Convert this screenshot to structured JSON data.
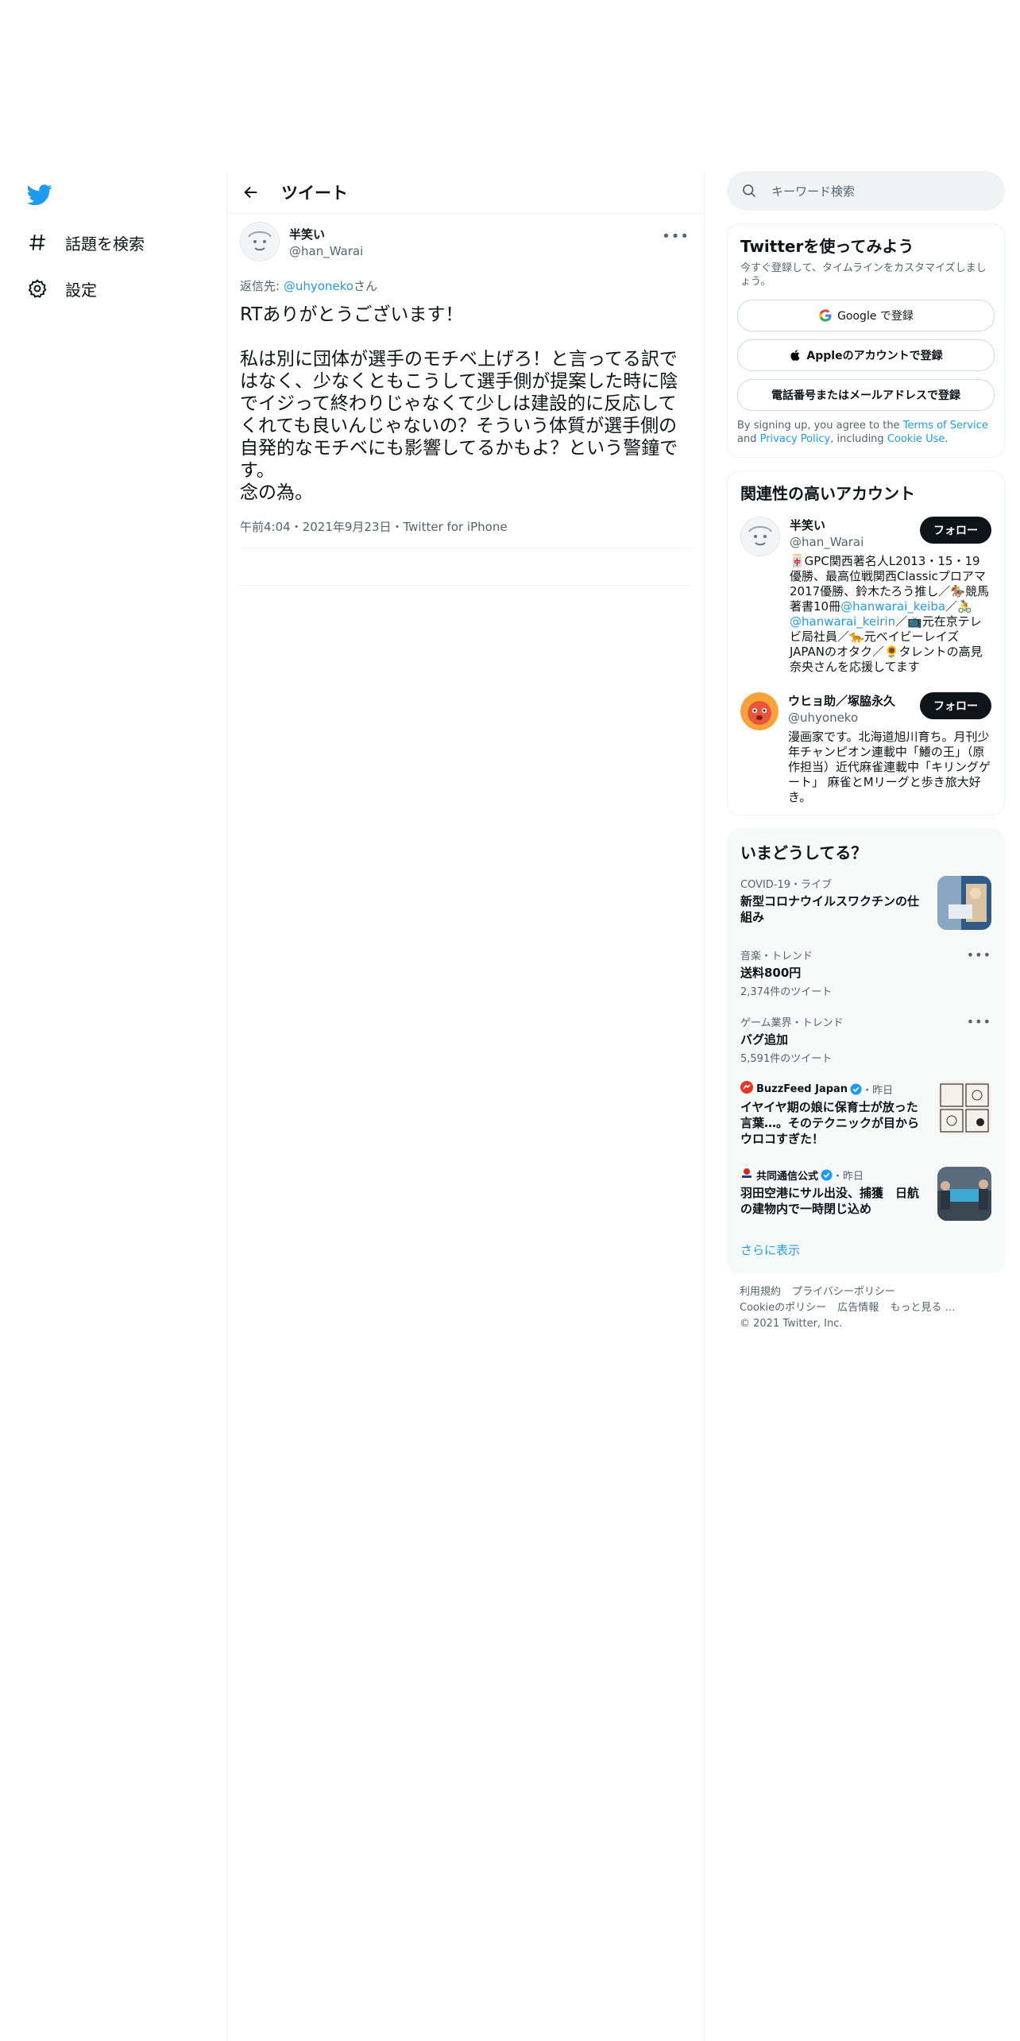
{
  "leftnav": {
    "items": [
      {
        "label": "話題を検索",
        "icon": "hashtag-icon"
      },
      {
        "label": "設定",
        "icon": "gear-icon"
      }
    ]
  },
  "header": {
    "title": "ツイート"
  },
  "tweet": {
    "author_name": "半笑い",
    "author_handle": "@han_Warai",
    "reply_prefix": "返信先:",
    "reply_handle": "@uhyoneko",
    "reply_suffix": "さん",
    "text": "RTありがとうございます！\n\n私は別に団体が選手のモチベ上げろ！と言ってる訳ではなく、少なくともこうして選手側が提案した時に陰でイジって終わりじゃなくて少しは建設的に反応してくれても良いんじゃないの？そういう体質が選手側の自発的なモチベにも影響してるかもよ？という警鐘です。\n念の為。",
    "meta": "午前4:04・2021年9月23日・Twitter for iPhone"
  },
  "search": {
    "placeholder": "キーワード検索"
  },
  "signup": {
    "title": "Twitterを使ってみよう",
    "subtitle": "今すぐ登録して、タイムラインをカスタマイズしましょう。",
    "google_label": "Google で登録",
    "apple_label": "Appleのアカウントで登録",
    "phone_label": "電話番号またはメールアドレスで登録",
    "terms_pre": "By signing up, you agree to the ",
    "terms_link": "Terms of Service",
    "terms_and": " and ",
    "privacy_link": "Privacy Policy",
    "terms_including": ", including ",
    "cookie_link": "Cookie Use",
    "terms_end": "."
  },
  "related": {
    "title": "関連性の高いアカウント",
    "follow_label": "フォロー",
    "accounts": [
      {
        "name": "半笑い",
        "handle": "@han_Warai",
        "bio_1": "🀄GPC関西著名人L2013・15・19優勝、最高位戦関西Classicプロアマ2017優勝、鈴木たろう推し／🏇競馬著書10冊",
        "bio_link1": "@hanwarai_keiba",
        "bio_2": "／🚴",
        "bio_link2": "@hanwarai_keirin",
        "bio_3": "／📺元在京テレビ局社員／🐆元ベイビーレイズJAPANのオタク／🌻タレントの高見奈央さんを応援してます"
      },
      {
        "name": "ウヒョ助／塚脇永久",
        "handle": "@uhyoneko",
        "bio": "漫画家です。北海道旭川育ち。月刊少年チャンピオン連載中「鱶の王」（原作担当）近代麻雀連載中「キリングゲート」 麻雀とMリーグと歩き旅大好き。"
      }
    ]
  },
  "trends": {
    "title": "いまどうしてる？",
    "items": [
      {
        "meta": "COVID-19・ライブ",
        "title": "新型コロナウイルスワクチンの仕組み"
      },
      {
        "meta": "音楽・トレンド",
        "title": "送料800円",
        "count": "2,374件のツイート"
      },
      {
        "meta": "ゲーム業界・トレンド",
        "title": "バグ追加",
        "count": "5,591件のツイート"
      },
      {
        "source": "BuzzFeed Japan",
        "time": "・昨日",
        "title": "イヤイヤ期の娘に保育士が放った言葉…。そのテクニックが目からウロコすぎた！"
      },
      {
        "source": "共同通信公式",
        "time": "・昨日",
        "title": "羽田空港にサル出没、捕獲　日航の建物内で一時閉じ込め"
      }
    ],
    "show_more": "さらに表示"
  },
  "footer": {
    "links": [
      "利用規約",
      "プライバシーポリシー",
      "Cookieのポリシー",
      "広告情報",
      "もっと見る …"
    ],
    "copyright": "© 2021 Twitter, Inc."
  },
  "colors": {
    "accent": "#1d9bf0",
    "text": "#0f1419",
    "secondary": "#536471",
    "border": "#eff3f4"
  }
}
